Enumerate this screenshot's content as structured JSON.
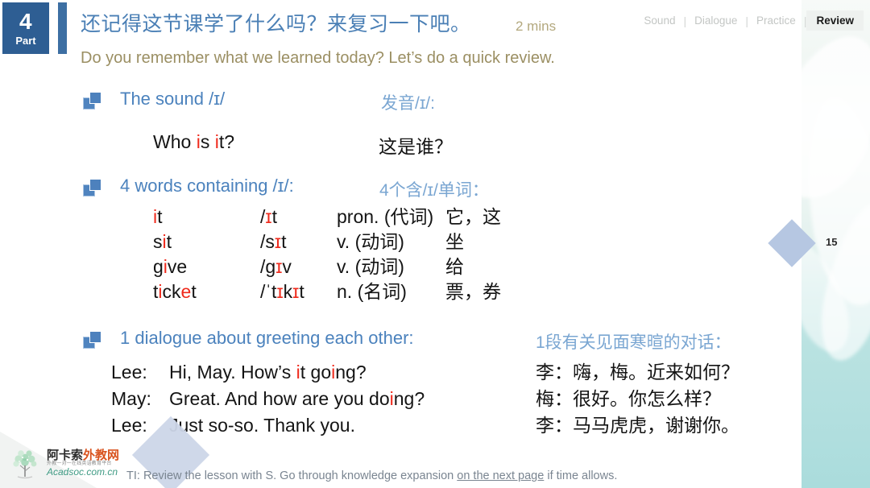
{
  "header": {
    "part_number": "4",
    "part_label": "Part",
    "title_cn": "还记得这节课学了什么吗？来复习一下吧。",
    "duration": "2 mins",
    "title_en": "Do you remember what we learned today? Let’s do a quick review."
  },
  "nav": {
    "items": [
      {
        "label": "Sound",
        "active": false
      },
      {
        "label": "Dialogue",
        "active": false
      },
      {
        "label": "Practice",
        "active": false
      },
      {
        "label": "Review",
        "active": true
      }
    ],
    "separator": "|"
  },
  "sections": {
    "sound": {
      "heading_en": "The sound /ɪ/",
      "heading_cn": "发音/ɪ/:",
      "example_en_pre": "Who ",
      "example_en_i1": "i",
      "example_en_mid": "s ",
      "example_en_i2": "i",
      "example_en_post": "t?",
      "example_cn": "这是谁？"
    },
    "words": {
      "heading_en": "4 words containing /ɪ/:",
      "heading_cn": "4个含/ɪ/单词：",
      "rows": [
        {
          "word_pre": "",
          "word_hl": "i",
          "word_post": "t",
          "ipa_pre": "/",
          "ipa_hl": "ɪ",
          "ipa_post": "t",
          "pos": "pron. (代词)",
          "meaning": "它，这"
        },
        {
          "word_pre": "s",
          "word_hl": "i",
          "word_post": "t",
          "ipa_pre": "/s",
          "ipa_hl": "ɪ",
          "ipa_post": "t",
          "pos": "v. (动词)",
          "meaning": "坐"
        },
        {
          "word_pre": "g",
          "word_hl": "i",
          "word_post": "ve",
          "ipa_pre": "/g",
          "ipa_hl": "ɪ",
          "ipa_post": "v",
          "pos": "v. (动词)",
          "meaning": "给"
        },
        {
          "word_pre": "t",
          "word_hl": "i",
          "word_post": "ck",
          "word_hl2": "e",
          "word_post2": "t",
          "ipa_pre": "/ˈt",
          "ipa_hl": "ɪ",
          "ipa_mid": "k",
          "ipa_hl2": "ɪ",
          "ipa_post": "t",
          "pos": "n. (名词)",
          "meaning": "票，券"
        }
      ]
    },
    "dialogue": {
      "heading_en": "1 dialogue about greeting each other:",
      "heading_cn": "1段有关见面寒暄的对话：",
      "lines": [
        {
          "speaker": "Lee:",
          "pre": "Hi, May. How’s ",
          "hl1": "i",
          "mid": "t go",
          "hl2": "i",
          "post": "ng?"
        },
        {
          "speaker": "May:",
          "pre": "Great. And how are you do",
          "hl1": "i",
          "mid": "",
          "hl2": "",
          "post": "ng?"
        },
        {
          "speaker": "Lee:",
          "pre": "Just so-so. Thank you.",
          "hl1": "",
          "mid": "",
          "hl2": "",
          "post": ""
        }
      ],
      "lines_cn": [
        "李：嗨，梅。近来如何？",
        "梅：很好。你怎么样？",
        "李：马马虎虎，谢谢你。"
      ]
    }
  },
  "footer": {
    "note_pre": "TI: Review the lesson with S. Go through knowledge expansion ",
    "note_link": "on the next page",
    "note_post": " if time allows."
  },
  "logo": {
    "name_black": "阿卡索",
    "name_orange": "外教网",
    "tagline": "外教一对一在线英语教育平台",
    "url": "Acadsoc.com.cn"
  },
  "page": {
    "number": "15"
  },
  "colors": {
    "brand_blue": "#2e5e93",
    "heading_blue": "#4b82bd",
    "heading_cn_blue": "#7aa6d2",
    "title_cn_blue": "#4a7fb5",
    "title_en_gold": "#9b8f63",
    "highlight_red": "#ef2a1c",
    "diamond_blue": "#b6c7e2",
    "footer_gray": "#7a8591"
  }
}
